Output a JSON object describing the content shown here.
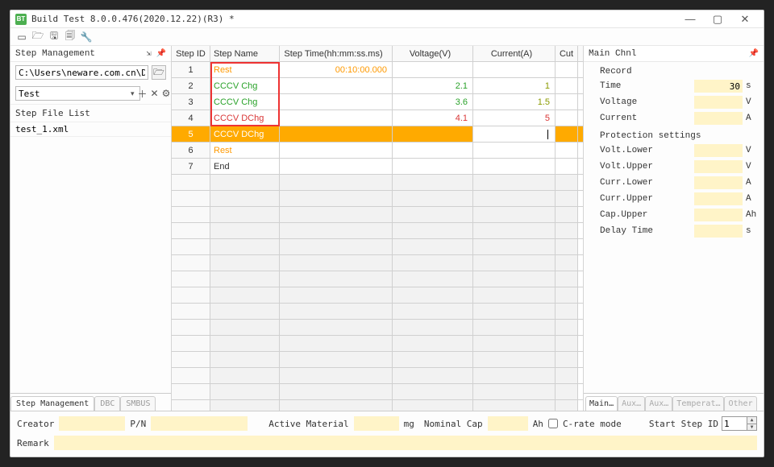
{
  "window": {
    "title": "Build Test 8.0.0.476(2020.12.22)(R3) *",
    "app_icon_text": "BT"
  },
  "left_panel": {
    "title": "Step Management",
    "path_value": "C:\\Users\\neware.com.cn\\Desktop\\",
    "combo_value": "Test",
    "file_list_label": "Step File List",
    "file_items": [
      "test_1.xml"
    ],
    "tabs": [
      "Step Management",
      "DBC",
      "SMBUS"
    ]
  },
  "grid": {
    "headers": {
      "id": "Step ID",
      "name": "Step Name",
      "time": "Step Time(hh:mm:ss.ms)",
      "voltage": "Voltage(V)",
      "current": "Current(A)",
      "cut": "Cut"
    },
    "rows": [
      {
        "id": "1",
        "name": "Rest",
        "name_cls": "txt-orange",
        "time": "00:10:00.000",
        "time_cls": "txt-orange",
        "voltage": "",
        "current": ""
      },
      {
        "id": "2",
        "name": "CCCV Chg",
        "name_cls": "txt-green",
        "time": "",
        "voltage": "2.1",
        "voltage_cls": "txt-green",
        "current": "1",
        "current_cls": "txt-dkgreen"
      },
      {
        "id": "3",
        "name": "CCCV Chg",
        "name_cls": "txt-green",
        "time": "",
        "voltage": "3.6",
        "voltage_cls": "txt-green",
        "current": "1.5",
        "current_cls": "txt-dkgreen"
      },
      {
        "id": "4",
        "name": "CCCV DChg",
        "name_cls": "txt-red",
        "time": "",
        "voltage": "4.1",
        "voltage_cls": "txt-red",
        "current": "5",
        "current_cls": "txt-red"
      },
      {
        "id": "5",
        "name": "CCCV DChg",
        "name_cls": "",
        "time": "",
        "voltage": "",
        "current": "",
        "selected": true,
        "editing_current": true
      },
      {
        "id": "6",
        "name": "Rest",
        "name_cls": "txt-orange",
        "time": "",
        "voltage": "",
        "current": ""
      },
      {
        "id": "7",
        "name": "End",
        "name_cls": "",
        "time": "",
        "voltage": "",
        "current": ""
      }
    ],
    "blank_rows": 15
  },
  "right_panel": {
    "title": "Main Chnl",
    "record_heading": "Record",
    "protection_heading": "Protection settings",
    "record": [
      {
        "label": "Time",
        "value": "30",
        "unit": "s"
      },
      {
        "label": "Voltage",
        "value": "",
        "unit": "V"
      },
      {
        "label": "Current",
        "value": "",
        "unit": "A"
      }
    ],
    "protection": [
      {
        "label": "Volt.Lower",
        "value": "",
        "unit": "V"
      },
      {
        "label": "Volt.Upper",
        "value": "",
        "unit": "V"
      },
      {
        "label": "Curr.Lower",
        "value": "",
        "unit": "A"
      },
      {
        "label": "Curr.Upper",
        "value": "",
        "unit": "A"
      },
      {
        "label": "Cap.Upper",
        "value": "",
        "unit": "Ah"
      },
      {
        "label": "Delay Time",
        "value": "",
        "unit": "s"
      }
    ],
    "tabs": [
      "Main…",
      "Aux…",
      "Aux…",
      "Temperat…",
      "Other"
    ]
  },
  "footer": {
    "creator_label": "Creator",
    "creator": "",
    "pn_label": "P/N",
    "pn": "",
    "active_material_label": "Active Material",
    "active_material": "",
    "active_material_unit": "mg",
    "nominal_cap_label": "Nominal Cap",
    "nominal_cap": "",
    "nominal_cap_unit": "Ah",
    "crate_checked": false,
    "crate_label": "C-rate mode",
    "start_step_label": "Start Step ID",
    "start_step_value": "1",
    "remark_label": "Remark",
    "remark": ""
  }
}
